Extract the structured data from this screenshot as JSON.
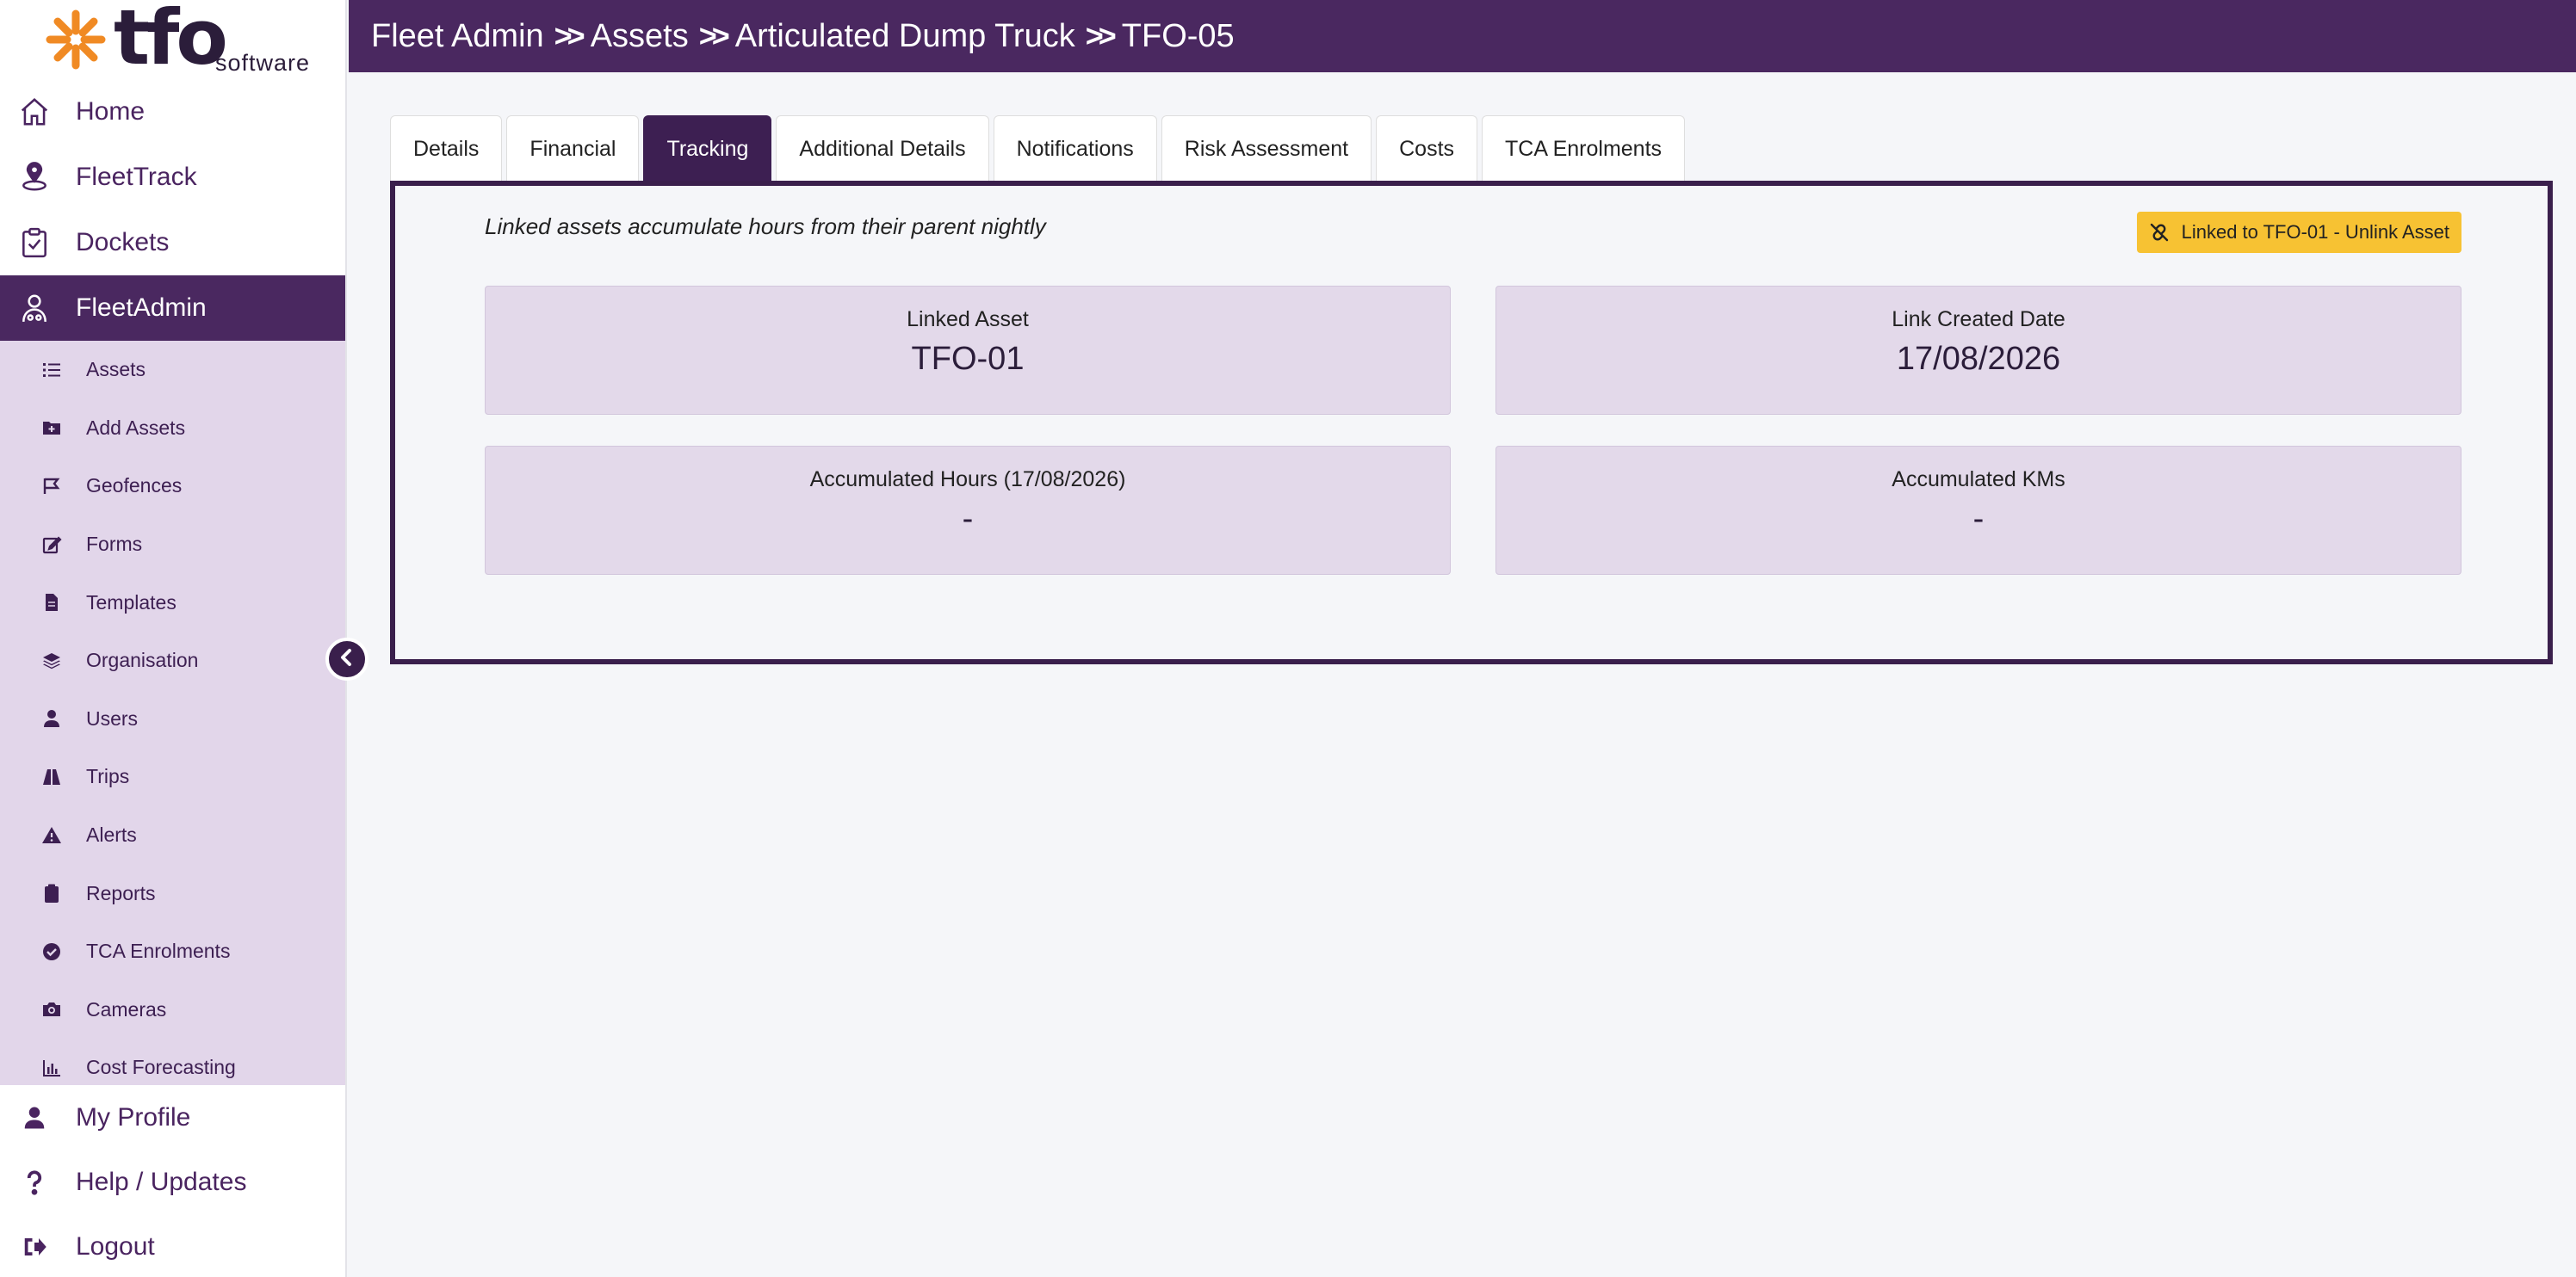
{
  "brand": {
    "logo_text": "tfo",
    "logo_sub": "software"
  },
  "nav": {
    "top": [
      {
        "label": "Home",
        "icon": "home-icon"
      },
      {
        "label": "FleetTrack",
        "icon": "map-pin-icon"
      },
      {
        "label": "Dockets",
        "icon": "clipboard-check-icon"
      },
      {
        "label": "FleetAdmin",
        "icon": "user-gear-icon"
      }
    ],
    "sub": [
      {
        "label": "Assets",
        "icon": "list-icon"
      },
      {
        "label": "Add Assets",
        "icon": "folder-plus-icon"
      },
      {
        "label": "Geofences",
        "icon": "map-flag-icon"
      },
      {
        "label": "Forms",
        "icon": "edit-icon"
      },
      {
        "label": "Templates",
        "icon": "file-icon"
      },
      {
        "label": "Organisation",
        "icon": "layers-icon"
      },
      {
        "label": "Users",
        "icon": "user-icon"
      },
      {
        "label": "Trips",
        "icon": "road-icon"
      },
      {
        "label": "Alerts",
        "icon": "warning-icon"
      },
      {
        "label": "Reports",
        "icon": "clipboard-icon"
      },
      {
        "label": "TCA Enrolments",
        "icon": "check-circle-icon"
      },
      {
        "label": "Cameras",
        "icon": "camera-icon"
      },
      {
        "label": "Cost Forecasting",
        "icon": "bar-chart-icon"
      }
    ],
    "bottom": [
      {
        "label": "My Profile",
        "icon": "user-icon"
      },
      {
        "label": "Help / Updates",
        "icon": "question-icon"
      },
      {
        "label": "Logout",
        "icon": "logout-icon"
      }
    ]
  },
  "header": {
    "breadcrumb": [
      "Fleet Admin",
      "Assets",
      "Articulated Dump Truck",
      "TFO-05"
    ]
  },
  "tabs": [
    "Details",
    "Financial",
    "Tracking",
    "Additional Details",
    "Notifications",
    "Risk Assessment",
    "Costs",
    "TCA Enrolments"
  ],
  "tracking": {
    "note": "Linked assets accumulate hours from their parent nightly",
    "unlink_label": "Linked to TFO-01 - Unlink Asset",
    "cards": [
      {
        "label": "Linked Asset",
        "value": "TFO-01"
      },
      {
        "label": "Link Created Date",
        "value": "17/08/2026"
      },
      {
        "label": "Accumulated Hours (17/08/2026)",
        "value": "-"
      },
      {
        "label": "Accumulated KMs",
        "value": "-"
      }
    ]
  },
  "colors": {
    "primary": "#4a2860",
    "submenu_bg": "#e2d6ea",
    "card_bg": "#e3d9ea",
    "accent": "#f7c233",
    "logo_orange": "#f08a24"
  }
}
